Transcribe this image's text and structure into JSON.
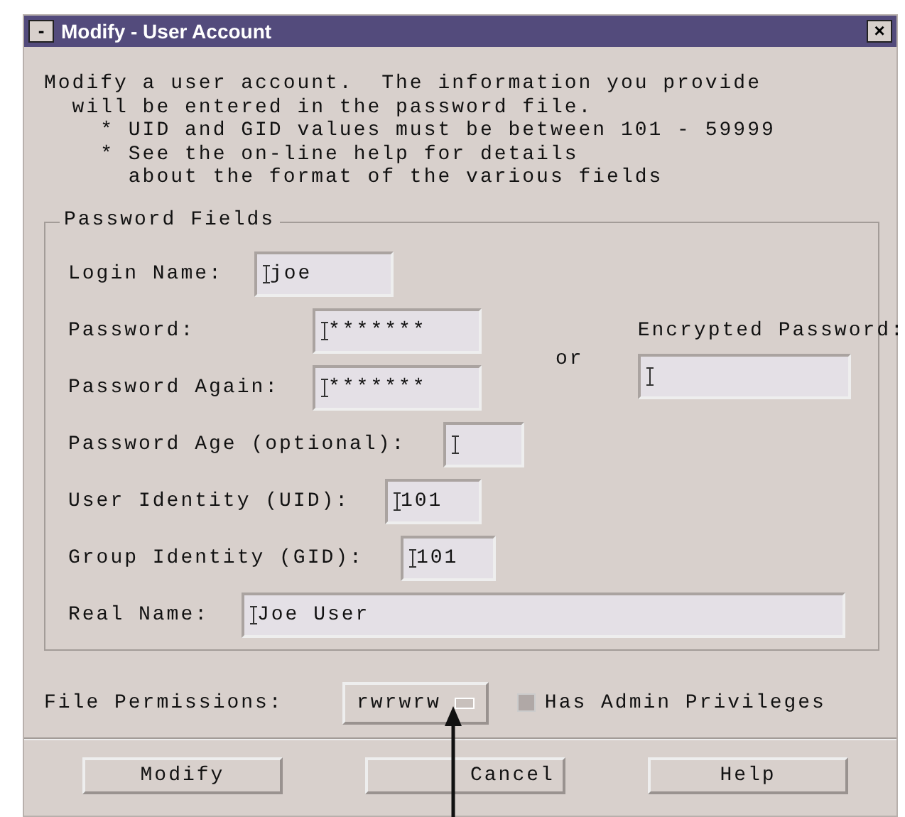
{
  "window": {
    "title": "Modify - User Account",
    "menu_glyph": "-",
    "close_glyph": "×"
  },
  "intro": [
    "Modify a user account.  The information you provide",
    "  will be entered in the password file.",
    "    * UID and GID values must be between 101 - 59999",
    "    * See the on-line help for details",
    "      about the format of the various fields"
  ],
  "group": {
    "title": "Password Fields"
  },
  "login": {
    "label": "Login Name:",
    "value": "joe"
  },
  "password": {
    "label": "Password:",
    "value": "*******"
  },
  "password_again": {
    "label": "Password Again:",
    "value": "*******"
  },
  "or_text": "or",
  "encrypted": {
    "label": "Encrypted Password:"
  },
  "age": {
    "label": "Password Age (optional):"
  },
  "uid": {
    "label": "User Identity (UID):",
    "value": "101"
  },
  "gid": {
    "label": "Group Identity (GID):",
    "value": "101"
  },
  "real_name": {
    "label": "Real Name:",
    "value": "Joe User"
  },
  "file_permissions": {
    "label": "File Permissions:",
    "value": "rwrwrw"
  },
  "admin": {
    "label": "Has Admin Privileges",
    "checked": false
  },
  "buttons": [
    "Modify",
    "Cancel",
    "Help"
  ]
}
